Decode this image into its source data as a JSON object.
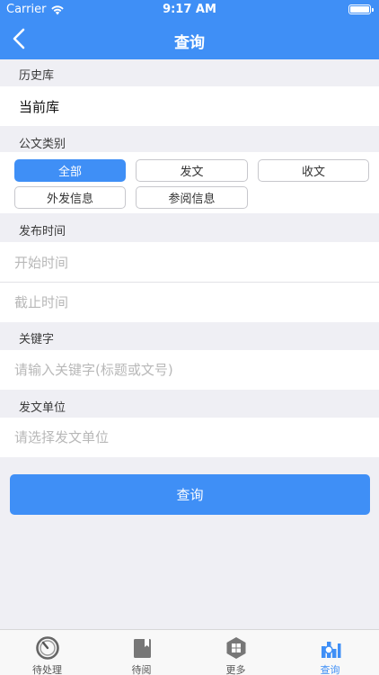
{
  "status": {
    "carrier": "Carrier",
    "time": "9:17 AM"
  },
  "nav": {
    "title": "查询"
  },
  "history": {
    "label": "历史库",
    "current": "当前库"
  },
  "category": {
    "label": "公文类别",
    "options": [
      "全部",
      "发文",
      "收文",
      "外发信息",
      "参阅信息"
    ],
    "selected": "全部"
  },
  "publish_time": {
    "label": "发布时间",
    "start_placeholder": "开始时间",
    "end_placeholder": "截止时间"
  },
  "keyword": {
    "label": "关键字",
    "placeholder": "请输入关键字(标题或文号)"
  },
  "unit": {
    "label": "发文单位",
    "placeholder": "请选择发文单位"
  },
  "query_button": "查询",
  "tabs": [
    {
      "label": "待处理",
      "icon": "timer-icon"
    },
    {
      "label": "待阅",
      "icon": "book-icon"
    },
    {
      "label": "更多",
      "icon": "grid-hexagon-icon"
    },
    {
      "label": "查询",
      "icon": "search-chart-icon",
      "active": true
    }
  ],
  "colors": {
    "primary": "#3f8ff6",
    "background": "#efeff4"
  }
}
